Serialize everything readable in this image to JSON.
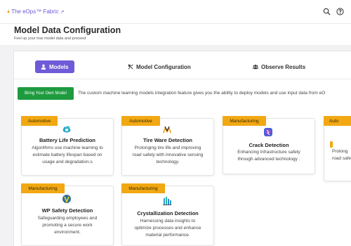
{
  "app": {
    "brand": "The eOps™ Fabric"
  },
  "page": {
    "title": "Model Data Configuration",
    "subtitle": "Feel up your true model data and proceed"
  },
  "tabs": [
    {
      "label": "Models",
      "icon": "user-icon",
      "active": true
    },
    {
      "label": "Model Configuration",
      "icon": "settings-sliders-icon",
      "active": false
    },
    {
      "label": "Observe Results",
      "icon": "users-icon",
      "active": false
    }
  ],
  "byom": {
    "button_label": "Bring Your Own Model",
    "description": "The custom machine learning models integration feature gives you the ability to deploy models and use input data from eO"
  },
  "cards": [
    {
      "tag": "Automotive",
      "title": "Battery Life Prediction",
      "desc_lines": [
        "Algorithms use machine learning to",
        "estimate battery lifespan based on",
        "usage and degradation.s"
      ],
      "icon": "battery-cloud-icon"
    },
    {
      "tag": "Automotive",
      "title": "Tire Ware Detection",
      "desc_lines": [
        "Prolonging tire life and improving",
        "road safety with innovative sensing",
        "technology."
      ],
      "icon": "tire-logo-icon"
    },
    {
      "tag": "Manufacturing",
      "title": "Crack Detection",
      "desc_lines": [
        "Enhancing infrastructure safety",
        "through advanced technology ."
      ],
      "icon": "crack-gem-icon"
    },
    {
      "tag": "Auto",
      "title": "",
      "desc_lines": [
        "Prolong",
        "road safe"
      ],
      "icon": ""
    },
    {
      "tag": "Manufacturing",
      "title": "WP Safety Detection",
      "desc_lines": [
        "Safeguarding employees and",
        "promoting a secure work",
        "environment."
      ],
      "icon": "safety-shield-icon"
    },
    {
      "tag": "Manufacturing",
      "title": "Crystallization Detection",
      "desc_lines": [
        "Harnessing data insights to",
        "optimize processes and enhance",
        "material performance."
      ],
      "icon": "crystal-icon"
    }
  ],
  "colors": {
    "accent": "#6f5ad8",
    "green": "#1f9b3f",
    "tag": "#f1a813"
  }
}
